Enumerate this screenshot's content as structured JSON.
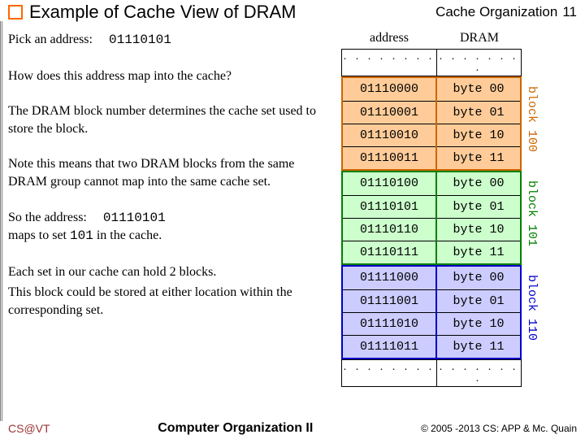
{
  "header": {
    "title": "Example of Cache View of DRAM",
    "organization": "Cache Organization",
    "pagenum": "11"
  },
  "left": {
    "p1_prefix": "Pick an address:",
    "p1_addr": "01110101",
    "p2": "How does this address map into the cache?",
    "p3": "The DRAM block number determines the cache set used to store the block.",
    "p4": "Note this means that two DRAM blocks from the same DRAM group cannot map into the same cache set.",
    "p5a": "So the address:",
    "p5addr": "01110101",
    "p5b": "maps to set",
    "p5set": "101",
    "p5c": "in the cache.",
    "p6": "Each set in our cache can hold 2 blocks.",
    "p7": "This block could be stored at either location within the corresponding set."
  },
  "table": {
    "hdr_address": "address",
    "hdr_dram": "DRAM",
    "ellipsis": ". . . . . . . .",
    "blocks": [
      {
        "label": "block 100",
        "rows": [
          {
            "addr": "01110000",
            "data": "byte 00"
          },
          {
            "addr": "01110001",
            "data": "byte 01"
          },
          {
            "addr": "01110010",
            "data": "byte 10"
          },
          {
            "addr": "01110011",
            "data": "byte 11"
          }
        ]
      },
      {
        "label": "block 101",
        "rows": [
          {
            "addr": "01110100",
            "data": "byte 00"
          },
          {
            "addr": "01110101",
            "data": "byte 01"
          },
          {
            "addr": "01110110",
            "data": "byte 10"
          },
          {
            "addr": "01110111",
            "data": "byte 11"
          }
        ]
      },
      {
        "label": "block 110",
        "rows": [
          {
            "addr": "01111000",
            "data": "byte 00"
          },
          {
            "addr": "01111001",
            "data": "byte 01"
          },
          {
            "addr": "01111010",
            "data": "byte 10"
          },
          {
            "addr": "01111011",
            "data": "byte 11"
          }
        ]
      }
    ]
  },
  "footer": {
    "left": "CS@VT",
    "center": "Computer Organization II",
    "right": "© 2005 -2013 CS: APP & Mc. Quain"
  }
}
